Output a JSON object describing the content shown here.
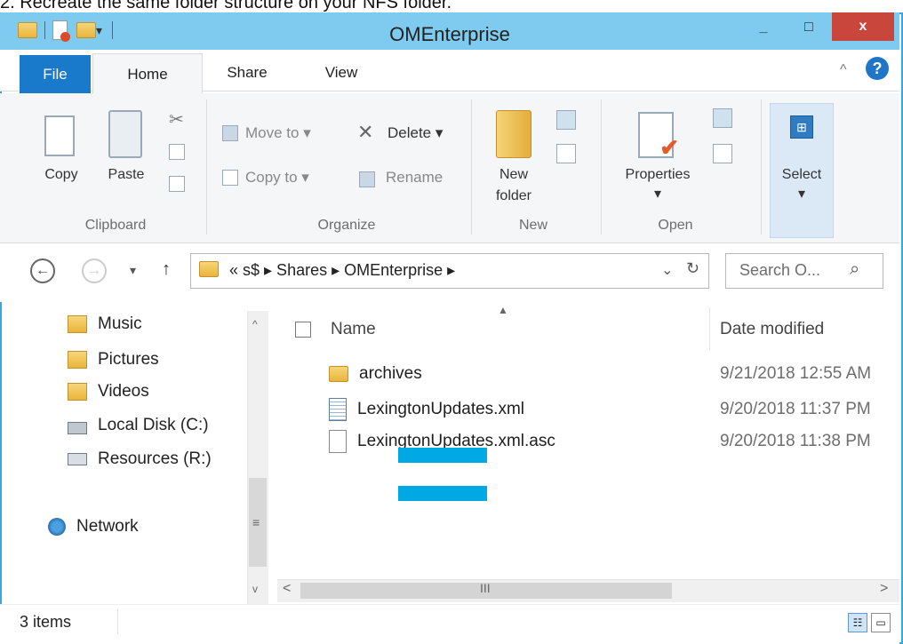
{
  "caption": "2.  Recreate the same folder structure on your NFS folder.",
  "window": {
    "title": "OMEnterprise"
  },
  "controls": {
    "minimize": "_",
    "maximize": "□",
    "close": "x"
  },
  "ribbon": {
    "tabs": {
      "file": "File",
      "home": "Home",
      "share": "Share",
      "view": "View"
    },
    "clipboard": {
      "copy": "Copy",
      "paste": "Paste",
      "group": "Clipboard"
    },
    "organize": {
      "move_to": "Move to ▾",
      "copy_to": "Copy to ▾",
      "delete": "Delete ▾",
      "rename": "Rename",
      "group": "Organize"
    },
    "new": {
      "new_folder_1": "New",
      "new_folder_2": "folder",
      "group": "New"
    },
    "open": {
      "properties": "Properties",
      "arrow": "▾",
      "group": "Open"
    },
    "select": {
      "label": "Select",
      "arrow": "▾"
    }
  },
  "address": {
    "back": "←",
    "forward": "→",
    "recent": "▾",
    "up": "↑",
    "breadcrumb": "«  s$  ▸  Shares  ▸  OMEnterprise  ▸",
    "dropdown": "⌄",
    "refresh": "↻",
    "search_placeholder": "Search O...",
    "search_icon": "⌕"
  },
  "navpane": [
    {
      "label": "Music",
      "icon": "music-icon"
    },
    {
      "label": "Pictures",
      "icon": "pictures-icon"
    },
    {
      "label": "Videos",
      "icon": "videos-icon"
    },
    {
      "label": "Local Disk (C:)",
      "icon": "drive-icon"
    },
    {
      "label": "Resources (R:)",
      "icon": "network-drive-icon"
    },
    {
      "label": "Network",
      "icon": "network-icon"
    }
  ],
  "list": {
    "col_name": "Name",
    "col_date": "Date modified",
    "files": [
      {
        "name": "archives",
        "date": "9/21/2018 12:55 AM",
        "icon": "folder-icon"
      },
      {
        "name": "LexingtonUpdates.xml",
        "date": "9/20/2018 11:37 PM",
        "icon": "xml-file-icon"
      },
      {
        "name": "LexingtonUpdates.xml.asc",
        "date": "9/20/2018 11:38 PM",
        "icon": "file-icon"
      }
    ]
  },
  "status": {
    "count": "3 items"
  },
  "colors": {
    "titlebar": "#7fcbf0",
    "file_tab": "#1979ca",
    "close": "#c9463d",
    "redaction": "#00a9e3"
  }
}
